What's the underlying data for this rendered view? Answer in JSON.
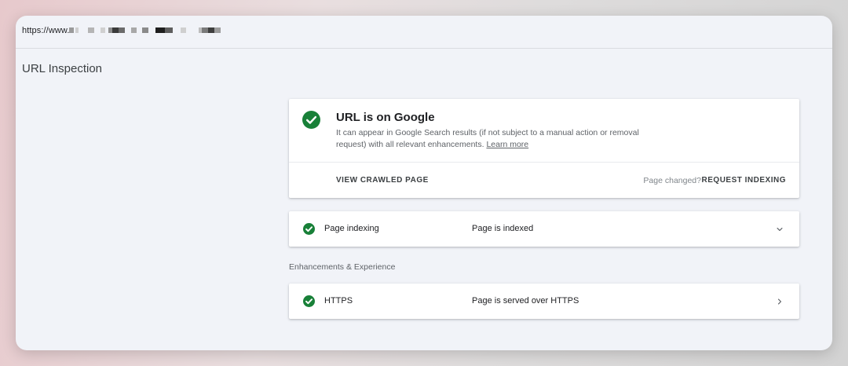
{
  "address_bar": {
    "url_prefix": "https://www."
  },
  "page": {
    "title": "URL Inspection"
  },
  "main_card": {
    "title": "URL is on Google",
    "description": "It can appear in Google Search results (if not subject to a manual action or removal request) with all relevant enhancements.",
    "learn_more": "Learn more",
    "view_crawled_page": "VIEW CRAWLED PAGE",
    "page_changed": "Page changed?",
    "request_indexing": "REQUEST INDEXING",
    "status_icon": "check-circle-icon"
  },
  "indexing_row": {
    "label": "Page indexing",
    "status": "Page is indexed",
    "icon": "chevron-down-icon"
  },
  "enhancements": {
    "section_label": "Enhancements & Experience",
    "rows": [
      {
        "label": "HTTPS",
        "status": "Page is served over HTTPS",
        "icon": "chevron-right-icon"
      }
    ]
  },
  "colors": {
    "success_green": "#188038",
    "window_bg": "#f1f3f8",
    "card_bg": "#ffffff"
  }
}
